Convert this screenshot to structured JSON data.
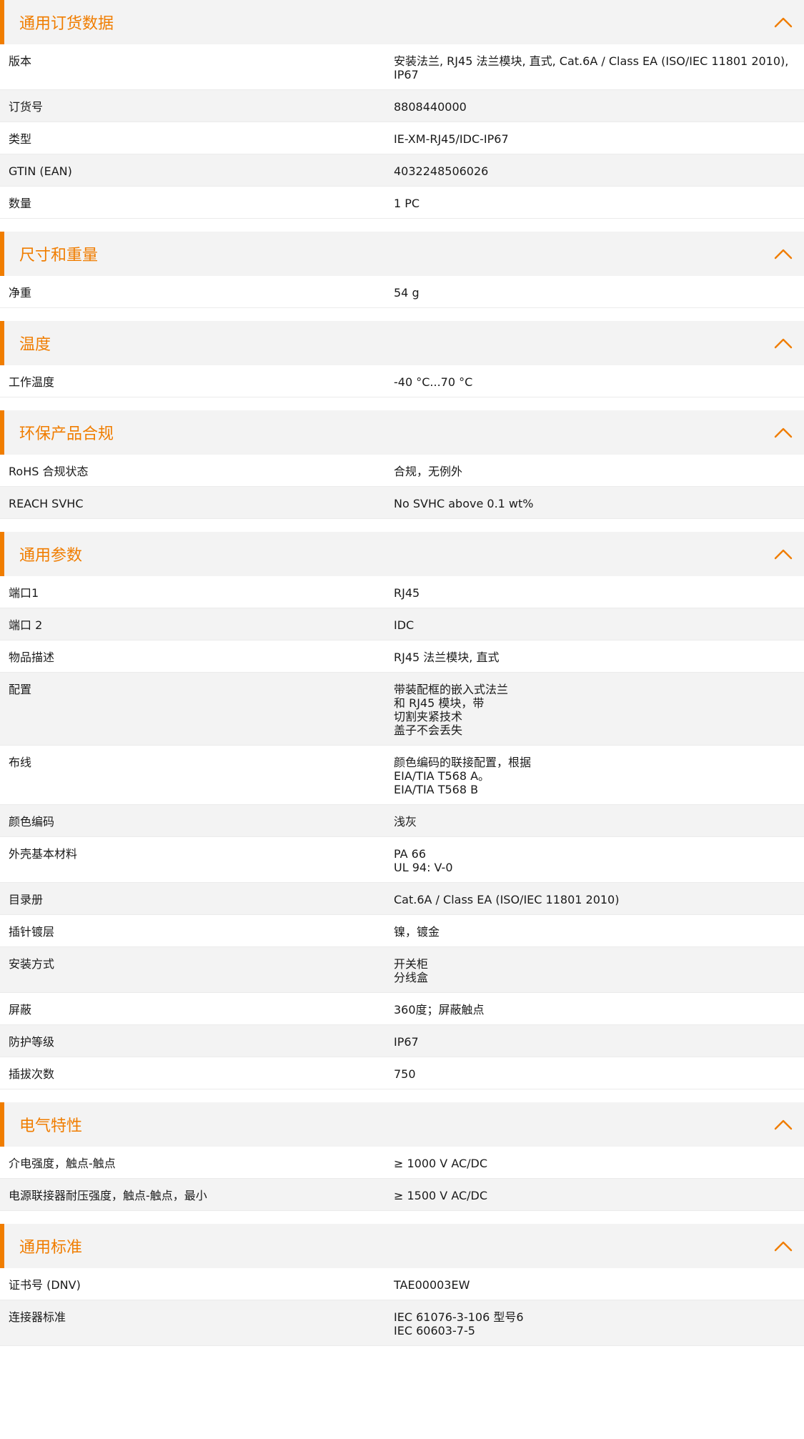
{
  "colors": {
    "accent": "#f07d00",
    "header_bg": "#f3f3f3",
    "row_alt_bg": "#f3f3f3"
  },
  "icons": {
    "section_toggle": "chevron-up-icon"
  },
  "sections": [
    {
      "title": "通用订货数据",
      "rows": [
        {
          "label": "版本",
          "value": [
            "安装法兰, RJ45 法兰模块, 直式, Cat.6A / Class EA (ISO/IEC 11801 2010),",
            "IP67"
          ]
        },
        {
          "label": "订货号",
          "value": [
            "8808440000"
          ]
        },
        {
          "label": "类型",
          "value": [
            "IE-XM-RJ45/IDC-IP67"
          ]
        },
        {
          "label": "GTIN (EAN)",
          "value": [
            "4032248506026"
          ]
        },
        {
          "label": "数量",
          "value": [
            "1  PC"
          ]
        }
      ]
    },
    {
      "title": "尺寸和重量",
      "rows": [
        {
          "label": "净重",
          "value": [
            "54  g"
          ]
        }
      ]
    },
    {
      "title": "温度",
      "rows": [
        {
          "label": "工作温度",
          "value": [
            "-40 °C...70 °C"
          ]
        }
      ]
    },
    {
      "title": "环保产品合规",
      "rows": [
        {
          "label": "RoHS 合规状态",
          "value": [
            "合规，无例外"
          ]
        },
        {
          "label": "REACH SVHC",
          "value": [
            "No SVHC above 0.1 wt%"
          ]
        }
      ]
    },
    {
      "title": "通用参数",
      "rows": [
        {
          "label": "端口1",
          "value": [
            "RJ45"
          ]
        },
        {
          "label": "端口 2",
          "value": [
            "IDC"
          ]
        },
        {
          "label": "物品描述",
          "value": [
            "RJ45 法兰模块, 直式"
          ]
        },
        {
          "label": "配置",
          "value": [
            "带装配框的嵌入式法兰",
            "和 RJ45 模块，带",
            "切割夹紧技术",
            "盖子不会丢失"
          ]
        },
        {
          "label": "布线",
          "value": [
            "颜色编码的联接配置，根据",
            "EIA/TIA T568 A。",
            "EIA/TIA T568 B"
          ]
        },
        {
          "label": "颜色编码",
          "value": [
            "浅灰"
          ]
        },
        {
          "label": "外壳基本材料",
          "value": [
            "PA 66",
            "UL 94: V-0"
          ]
        },
        {
          "label": "目录册",
          "value": [
            "Cat.6A / Class EA (ISO/IEC 11801 2010)"
          ]
        },
        {
          "label": "插针镀层",
          "value": [
            "镍，镀金"
          ]
        },
        {
          "label": "安装方式",
          "value": [
            "开关柜",
            "分线盒"
          ]
        },
        {
          "label": "屏蔽",
          "value": [
            "360度；屏蔽触点"
          ]
        },
        {
          "label": "防护等级",
          "value": [
            "IP67"
          ]
        },
        {
          "label": "插拔次数",
          "value": [
            "750"
          ]
        }
      ]
    },
    {
      "title": "电气特性",
      "rows": [
        {
          "label": "介电强度，触点-触点",
          "value": [
            "≥ 1000 V AC/DC"
          ]
        },
        {
          "label": "电源联接器耐压强度，触点-触点，最小",
          "value": [
            "≥ 1500 V AC/DC"
          ]
        }
      ]
    },
    {
      "title": "通用标准",
      "rows": [
        {
          "label": "证书号 (DNV)",
          "value": [
            "TAE00003EW"
          ]
        },
        {
          "label": "连接器标准",
          "value": [
            "IEC 61076-3-106 型号6",
            "IEC 60603-7-5"
          ]
        }
      ]
    }
  ]
}
